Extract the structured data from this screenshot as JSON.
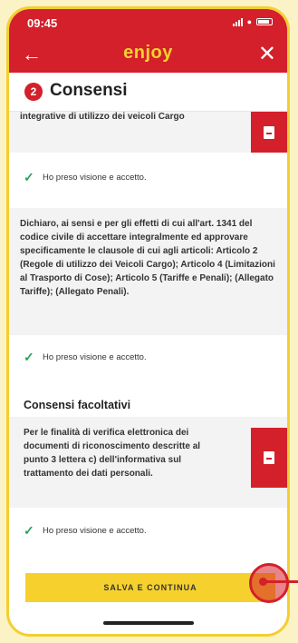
{
  "status_bar": {
    "time": "09:45"
  },
  "app_bar": {
    "back_icon": "←",
    "logo": "enjoy",
    "close_icon": "✕"
  },
  "section": {
    "step": "2",
    "title": "Consensi"
  },
  "cards": {
    "top_text": "integrative di utilizzo dei veicoli Cargo",
    "check1": "Ho preso visione e accetto.",
    "mid_text": "Dichiaro, ai sensi e per gli effetti di cui all'art. 1341 del codice civile di accettare integralmente ed approvare specificamente le clausole di cui agli articoli: Articolo 2 (Regole di utilizzo dei Veicoli Cargo); Articolo 4 (Limitazioni al Trasporto di Cose); Articolo 5 (Tariffe e Penali); (Allegato Tariffe); (Allegato Penali).",
    "check2": "Ho preso visione e accetto.",
    "optional_title": "Consensi facoltativi",
    "optional_text": "Per le finalità di verifica elettronica dei documenti di riconoscimento descritte al punto 3 lettera c) dell'informativa sul trattamento dei dati personali.",
    "check3": "Ho preso visione e accetto."
  },
  "save_button": "SALVA E CONTINUA",
  "colors": {
    "brand_red": "#d3202a",
    "brand_yellow": "#f6d12e",
    "check_green": "#2aa25a"
  }
}
